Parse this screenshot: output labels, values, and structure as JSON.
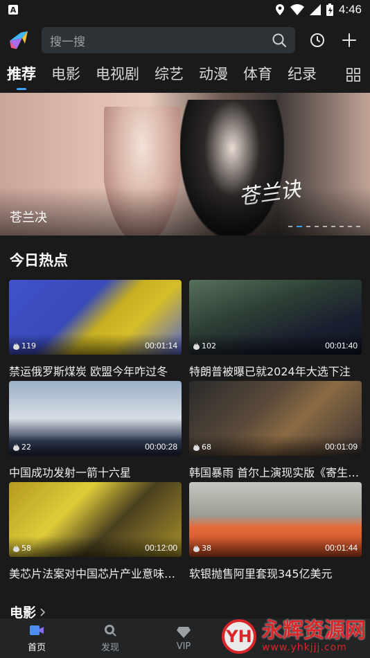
{
  "status_bar": {
    "time": "4:46",
    "notif_letter": "A"
  },
  "search": {
    "placeholder": "搜一搜"
  },
  "tabs": [
    "推荐",
    "电影",
    "电视剧",
    "综艺",
    "动漫",
    "体育",
    "纪录"
  ],
  "banner": {
    "title": "苍兰决",
    "brand_text": "苍兰诀"
  },
  "section": {
    "title": "今日热点"
  },
  "videos": [
    {
      "views": "119",
      "duration": "00:01:14",
      "title": "禁运俄罗斯煤炭 欧盟今年咋过冬"
    },
    {
      "views": "102",
      "duration": "00:01:40",
      "title": "特朗普被曝已就2024年大选下注"
    },
    {
      "views": "22",
      "duration": "00:00:28",
      "title": "中国成功发射一箭十六星"
    },
    {
      "views": "68",
      "duration": "00:01:09",
      "title": "韩国暴雨 首尔上演现实版《寄生虫》"
    },
    {
      "views": "58",
      "duration": "00:12:00",
      "title": "美芯片法案对中国芯片产业意味着什么"
    },
    {
      "views": "38",
      "duration": "00:01:44",
      "title": "软银抛售阿里套现345亿美元"
    }
  ],
  "more_section": {
    "title": "电影"
  },
  "bottom_nav": [
    {
      "label": "首页",
      "icon": "video-camera-icon"
    },
    {
      "label": "发现",
      "icon": "search-icon"
    },
    {
      "label": "VIP",
      "icon": "diamond-icon"
    }
  ],
  "watermark": {
    "logo_text": "YH",
    "name": "永辉资源网",
    "url": "www.yhkjjj.com"
  },
  "colors": {
    "accent": "#3aa0ff",
    "background": "#1a1a1a",
    "search_bg": "#2c3236"
  }
}
